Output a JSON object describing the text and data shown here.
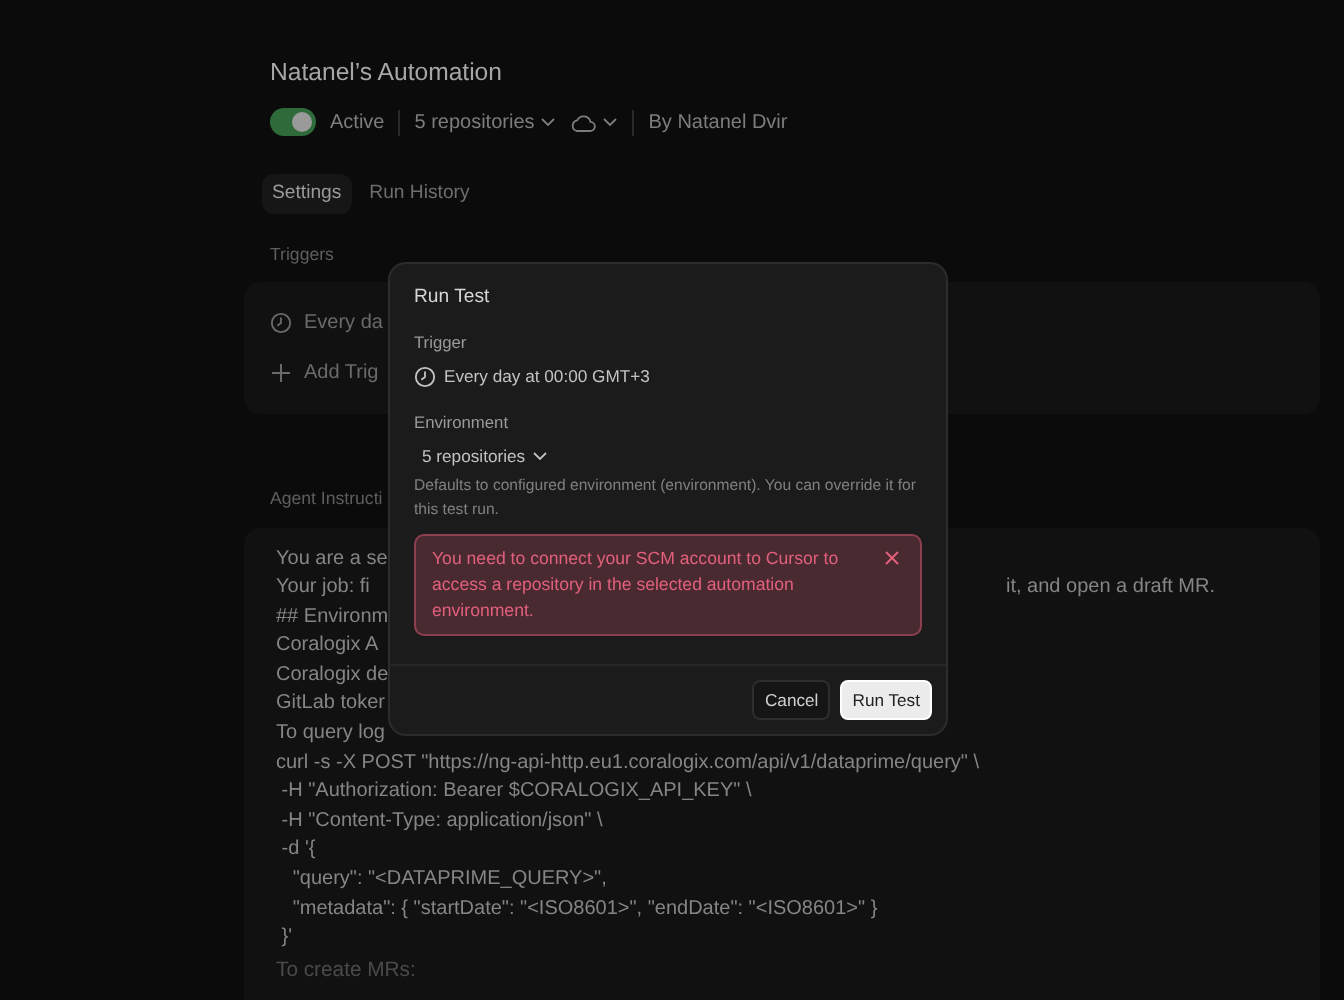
{
  "header": {
    "title": "Natanel’s Automation",
    "active": true,
    "status_label": "Active",
    "repositories": "5 repositories",
    "author": "By Natanel Dvir"
  },
  "tabs": [
    {
      "label": "Settings",
      "selected": true
    },
    {
      "label": "Run History",
      "selected": false
    }
  ],
  "triggers": {
    "heading": "Triggers",
    "items": [
      {
        "kind": "schedule",
        "label": "Every da"
      },
      {
        "kind": "add",
        "label": "Add Trig"
      }
    ]
  },
  "instructions": {
    "heading": "Agent Instructi",
    "lines": [
      {
        "left": "You are a se"
      },
      {
        "left": "Your job: fi",
        "right": "it, and open a draft MR."
      },
      {
        "left": "## Environm"
      },
      {
        "left": "Coralogix A"
      },
      {
        "left": "Coralogix de"
      },
      {
        "left": "GitLab toker"
      },
      {
        "left": "To query log"
      },
      {
        "left": "curl -s -X POST \"https://ng-api-http.eu1.coralogix.com/api/v1/dataprime/query\" \\"
      },
      {
        "left": " -H \"Authorization: Bearer $CORALOGIX_API_KEY\" \\"
      },
      {
        "left": " -H \"Content-Type: application/json\" \\"
      },
      {
        "left": " -d '{"
      },
      {
        "left": "   \"query\": \"<DATAPRIME_QUERY>\","
      },
      {
        "left": "   \"metadata\": { \"startDate\": \"<ISO8601>\", \"endDate\": \"<ISO8601>\" }"
      },
      {
        "left": " }'"
      }
    ],
    "faded_line": "To create MRs:"
  },
  "modal": {
    "title": "Run Test",
    "trigger_label": "Trigger",
    "trigger_value": "Every day at 00:00 GMT+3",
    "environment_label": "Environment",
    "environment_value": "5 repositories",
    "help": "Defaults to configured environment (environment). You can override it for this test run.",
    "alert": "You need to connect your SCM account to Cursor to access a repository in the selected automation environment.",
    "buttons": [
      {
        "label": "Cancel",
        "kind": "secondary"
      },
      {
        "label": "Run Test",
        "kind": "primary"
      }
    ]
  }
}
